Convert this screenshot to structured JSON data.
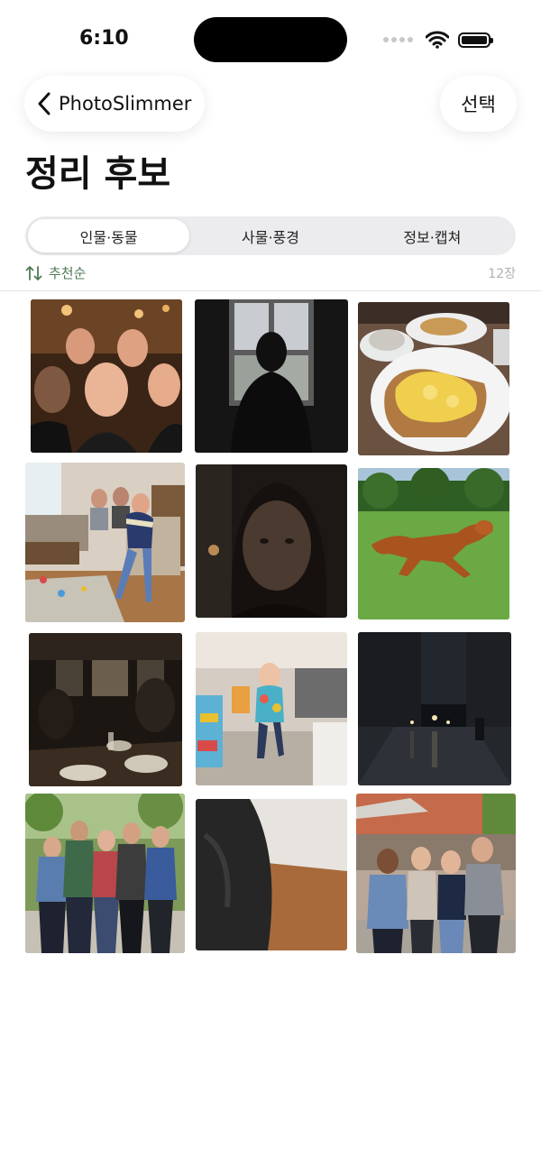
{
  "status": {
    "time": "6:10",
    "battery_level": 1.0
  },
  "nav": {
    "back_label": "PhotoSlimmer",
    "select_label": "선택"
  },
  "title": "정리 후보",
  "segments": [
    {
      "label": "인물·동물",
      "selected": true
    },
    {
      "label": "사물·풍경",
      "selected": false
    },
    {
      "label": "정보·캡쳐",
      "selected": false
    }
  ],
  "sort": {
    "label": "추천순"
  },
  "count": "12장",
  "colors": {
    "accent_green": "#4f7a55"
  },
  "photos": [
    {
      "subject": "group-selfie-bar"
    },
    {
      "subject": "silhouette-window"
    },
    {
      "subject": "eggs-on-toast"
    },
    {
      "subject": "child-living-room"
    },
    {
      "subject": "dark-selfie"
    },
    {
      "subject": "dog-running-grass"
    },
    {
      "subject": "dark-restaurant"
    },
    {
      "subject": "toddler-blurry"
    },
    {
      "subject": "night-street"
    },
    {
      "subject": "friends-park"
    },
    {
      "subject": "blurry-floor"
    },
    {
      "subject": "friends-patio"
    }
  ]
}
